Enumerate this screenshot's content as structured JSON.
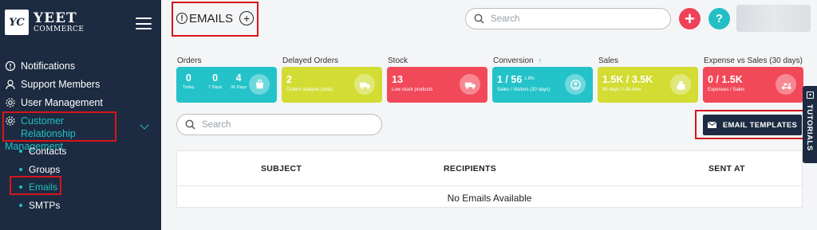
{
  "brand": {
    "logo_mark": "YC",
    "name": "YEET",
    "subtitle": "COMMERCE"
  },
  "sidebar": {
    "items": [
      {
        "label": "Notifications",
        "icon": "bell-icon"
      },
      {
        "label": "Support Members",
        "icon": "support-icon"
      },
      {
        "label": "User Management",
        "icon": "gear-icon"
      }
    ],
    "crm": {
      "line1": "Customer Relationship",
      "line2": "Management",
      "icon": "crm-icon"
    },
    "sub_items": [
      {
        "label": "Contacts"
      },
      {
        "label": "Groups"
      },
      {
        "label": "Emails"
      },
      {
        "label": "SMTPs"
      }
    ]
  },
  "header": {
    "info_glyph": "!",
    "title": "EMAILS",
    "add_glyph": "+",
    "search_placeholder": "Search",
    "add_button": "+",
    "help_button": "?"
  },
  "stats": [
    {
      "label": "Orders",
      "color": "#23c3c9",
      "columns": [
        {
          "value": "0",
          "label": "Today"
        },
        {
          "value": "0",
          "label": "7 Days"
        },
        {
          "value": "4",
          "label": "30 Days"
        }
      ]
    },
    {
      "label": "Delayed Orders",
      "color": "#d2dc33",
      "value": "2",
      "sub": "Orders delayed (total)"
    },
    {
      "label": "Stock",
      "color": "#f1495a",
      "value": "13",
      "sub": "Low stock products"
    },
    {
      "label": "Conversion",
      "trend": "↑",
      "color": "#23c3c9",
      "value": "1 / 56",
      "extra": "1.8%",
      "sub": "Sales / Visitors (30 days)"
    },
    {
      "label": "Sales",
      "color": "#d2dc33",
      "value": "1.5K / 3.5K",
      "sub": "30 days / Life time"
    },
    {
      "label": "Expense vs Sales (30 days)",
      "color": "#f1495a",
      "value": "0 / 1.5K",
      "sub": "Expenses / Sales"
    }
  ],
  "content": {
    "search_placeholder": "Search",
    "email_templates_label": "EMAIL TEMPLATES",
    "tutorials_label": "TUTORIALS",
    "tutorials_glyph": "▾"
  },
  "table": {
    "columns": [
      "SUBJECT",
      "RECIPIENTS",
      "SENT AT"
    ],
    "empty_message": "No Emails Available"
  }
}
